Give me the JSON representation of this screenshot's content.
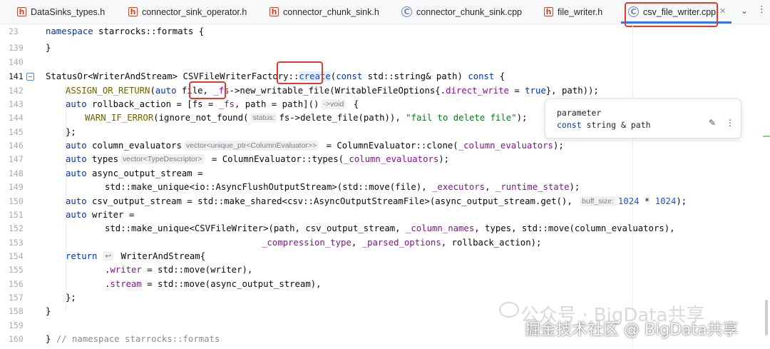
{
  "tabs": [
    {
      "label": "DataSinks_types.h",
      "icon": "header-file-icon"
    },
    {
      "label": "connector_sink_operator.h",
      "icon": "header-file-icon"
    },
    {
      "label": "connector_chunk_sink.h",
      "icon": "header-file-icon"
    },
    {
      "label": "connector_chunk_sink.cpp",
      "icon": "cpp-file-icon"
    },
    {
      "label": "file_writer.h",
      "icon": "header-file-icon"
    },
    {
      "label": "csv_file_writer.cpp",
      "icon": "cpp-file-icon",
      "active": true
    }
  ],
  "line_numbers": [
    "23",
    "139",
    "140",
    "141",
    "142",
    "143",
    "144",
    "145",
    "146",
    "147",
    "148",
    "149",
    "150",
    "151",
    "152",
    "153",
    "154",
    "155",
    "156",
    "157",
    "158",
    "159",
    "160"
  ],
  "code": {
    "l23_a": "namespace",
    "l23_b": " starrocks::formats {",
    "l139": "}",
    "l141_a": "StatusOr<WriterAndStream> CSVFileWriterFactory::",
    "l141_b": "create",
    "l141_c": "(",
    "l141_d": "const",
    "l141_e": " std::string& path) ",
    "l141_f": "const",
    "l141_g": " {",
    "l142_a": "ASSIGN_OR_RETURN",
    "l142_b": "(",
    "l142_c": "auto",
    "l142_d": " file, ",
    "l142_e": "_fs",
    "l142_f": "->new_writable_file(WritableFileOptions{.",
    "l142_g": "direct_write",
    "l142_h": " = ",
    "l142_i": "true",
    "l142_j": "}, path));",
    "l143_a": "auto",
    "l143_b": " rollback_action = [fs = ",
    "l143_c": "_fs",
    "l143_d": ", path = path]()",
    "l143_hint": "->void",
    "l143_e": " {",
    "l144_a": "WARN_IF_ERROR",
    "l144_b": "(ignore_not_found(",
    "l144_hint": "status:",
    "l144_c": "fs->delete_file(path)), ",
    "l144_d": "\"fail to delete file\"",
    "l144_e": ");",
    "l145": "};",
    "l146_a": "auto",
    "l146_b": " column_evaluators",
    "l146_hint": "vector<unique_ptr<ColumnEvaluator>>",
    "l146_c": " = ColumnEvaluator::clone(",
    "l146_d": "_column_evaluators",
    "l146_e": ");",
    "l147_a": "auto",
    "l147_b": " types",
    "l147_hint": "vector<TypeDescriptor>",
    "l147_c": " = ColumnEvaluator::types(",
    "l147_d": "_column_evaluators",
    "l147_e": ");",
    "l148_a": "auto",
    "l148_b": " async_output_stream =",
    "l149_a": "std::make_unique<io::AsyncFlushOutputStream>(std::move(file), ",
    "l149_b": "_executors",
    "l149_c": ", ",
    "l149_d": "_runtime_state",
    "l149_e": ");",
    "l150_a": "auto",
    "l150_b": " csv_output_stream = std::make_shared<csv::AsyncOutputStreamFile>(async_output_stream.get(), ",
    "l150_hint": "buff_size:",
    "l150_c": "1024",
    "l150_d": " * ",
    "l150_e": "1024",
    "l150_f": ");",
    "l151_a": "auto",
    "l151_b": " writer =",
    "l152_a": "std::make_unique<CSVFileWriter>(path, csv_output_stream, ",
    "l152_b": "_column_names",
    "l152_c": ", types, std::move(column_evaluators),",
    "l153_a": "_compression_type",
    "l153_b": ", ",
    "l153_c": "_parsed_options",
    "l153_d": ", rollback_action);",
    "l154_a": "return",
    "l154_b": " WriterAndStream{",
    "l155_a": ".",
    "l155_b": "writer",
    "l155_c": " = std::move(writer),",
    "l156_a": ".",
    "l156_b": "stream",
    "l156_c": " = std::move(async_output_stream),",
    "l157": "};",
    "l158": "}",
    "l160_a": "} ",
    "l160_b": "// namespace starrocks::formats"
  },
  "popup": {
    "title": "parameter",
    "sig_kw": "const",
    "sig_rest": " string & path"
  },
  "watermark": {
    "line1": "公众号 · BigData共享",
    "line2": "掘金技术社区 @ BigData共享"
  },
  "colors": {
    "keyword": "#0033b3",
    "field": "#871094",
    "string": "#067d17",
    "number": "#1750eb",
    "annotation_box": "#e03c2d",
    "active_tab_underline": "#3574f0"
  }
}
